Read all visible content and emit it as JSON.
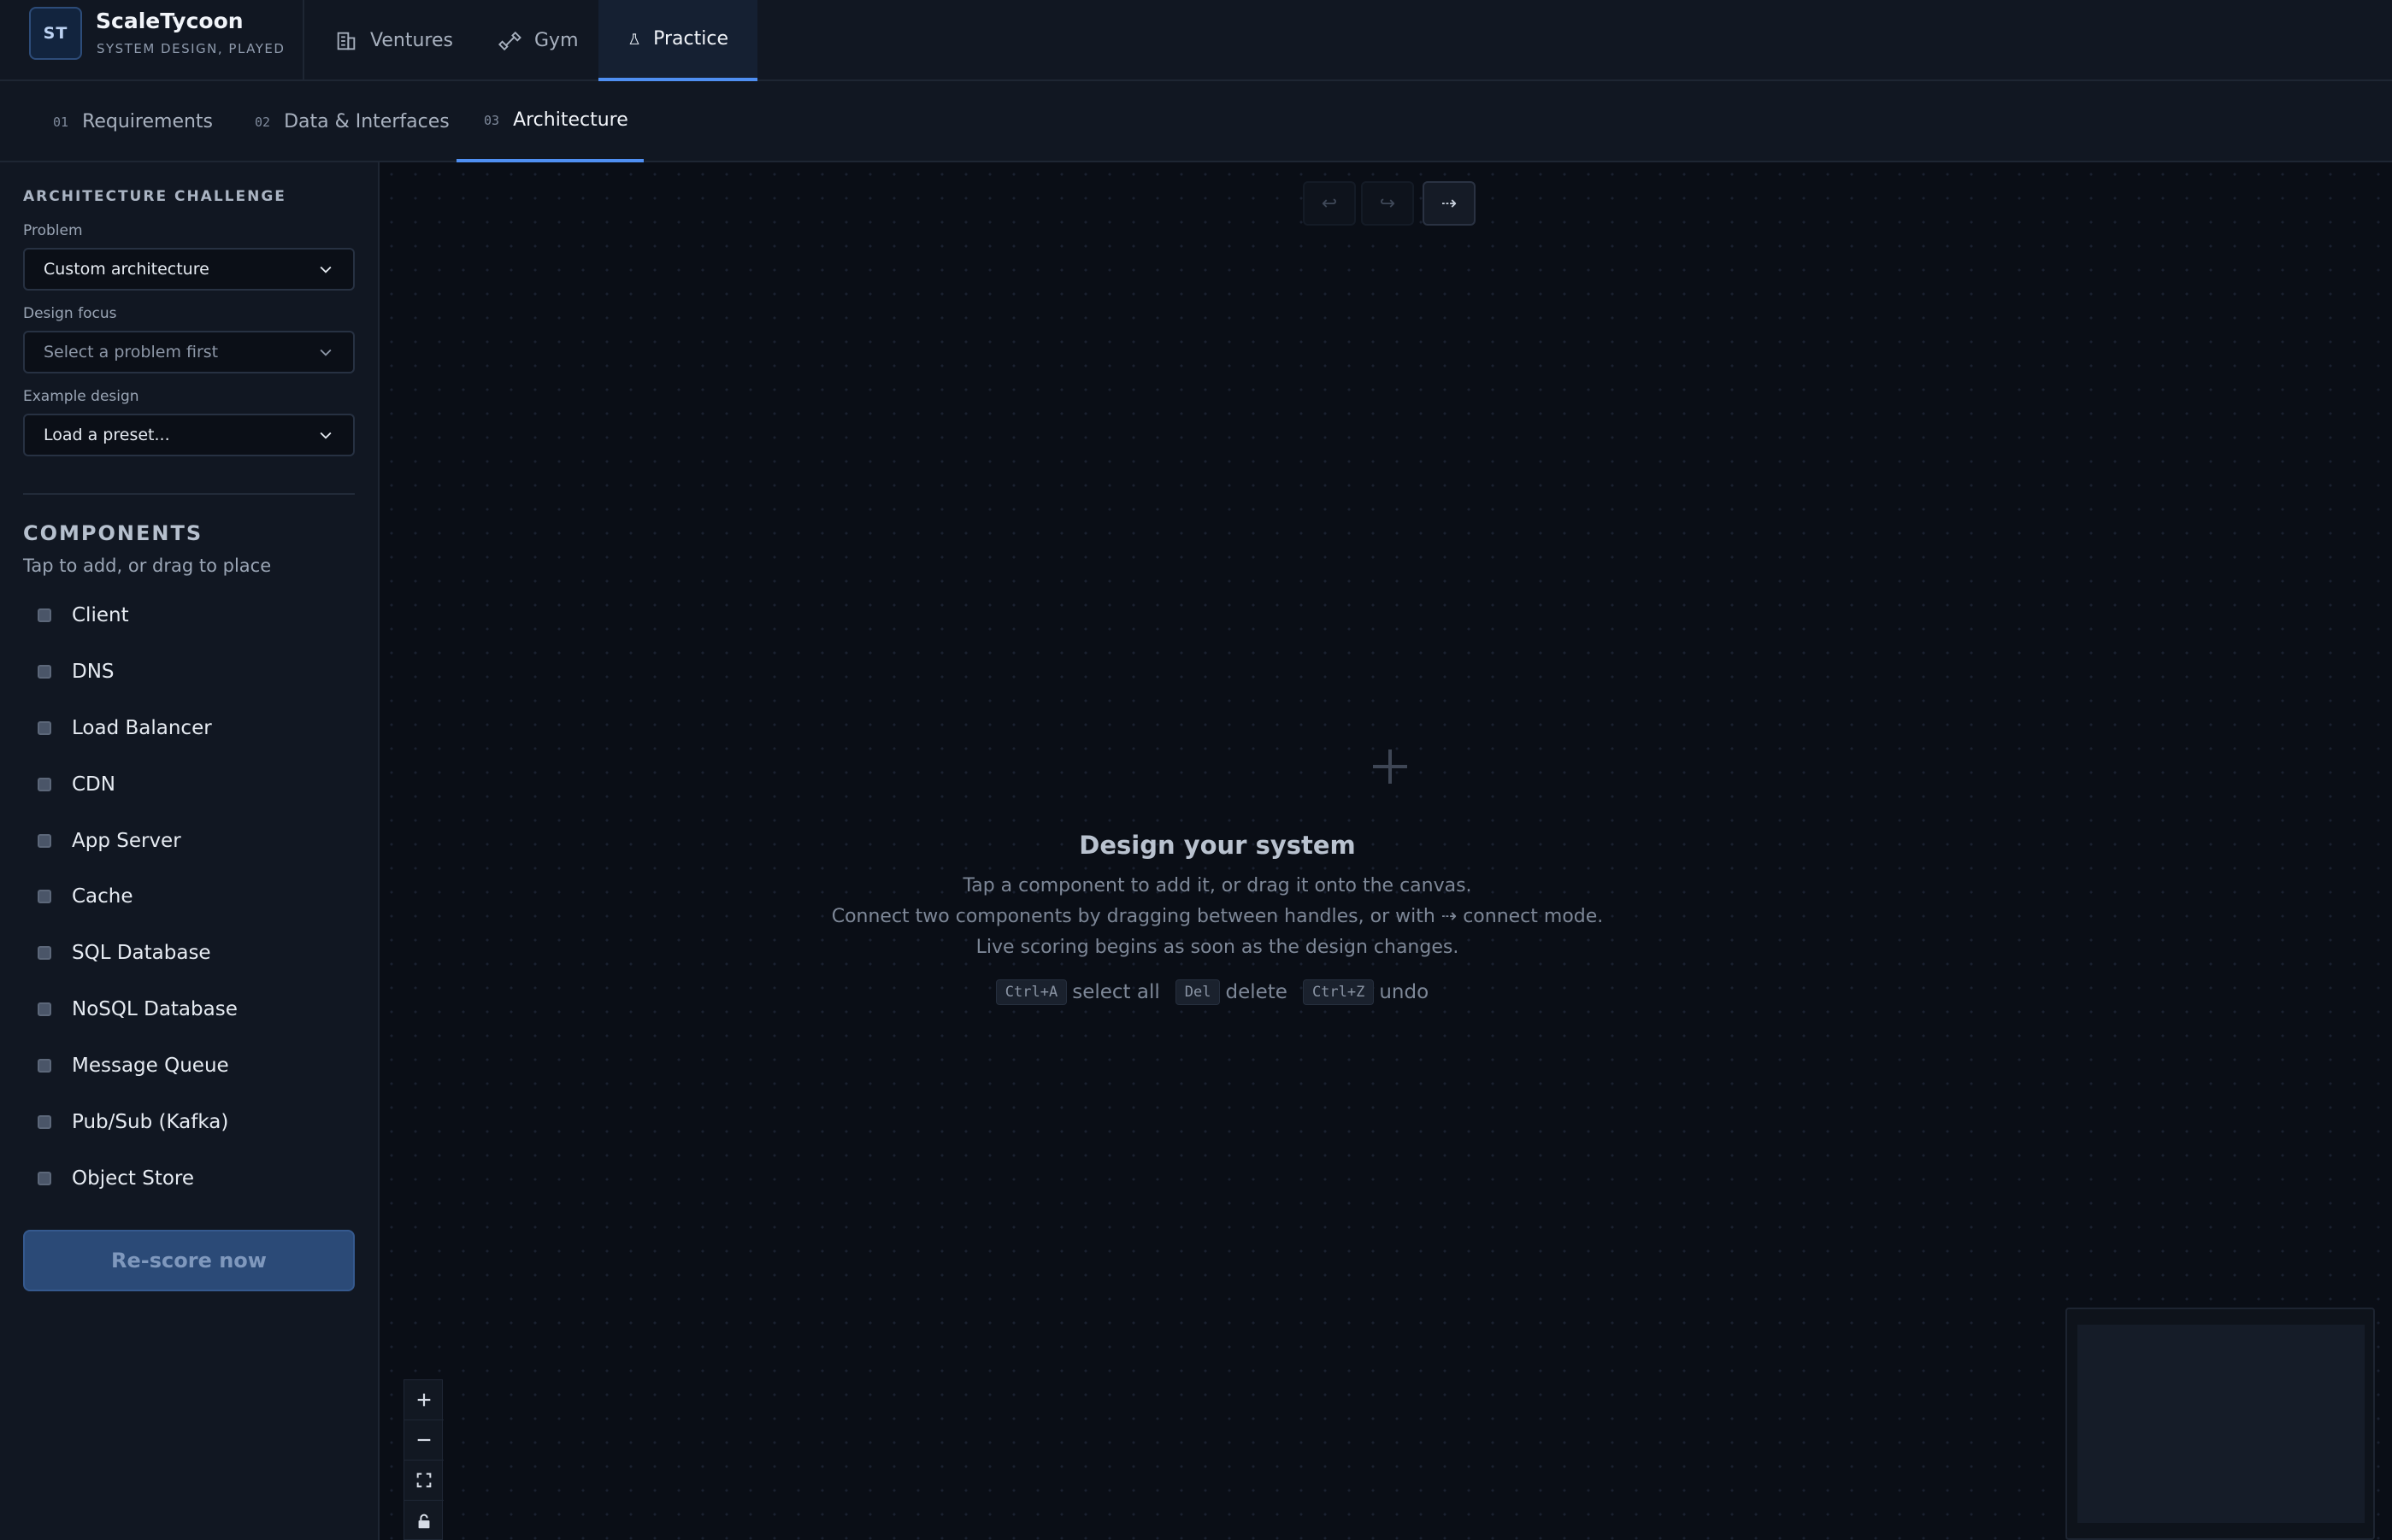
{
  "brand": {
    "logo": "ST",
    "name": "ScaleTycoon",
    "tagline": "SYSTEM DESIGN, PLAYED"
  },
  "nav": [
    {
      "label": "Ventures",
      "icon": "building-icon",
      "active": false
    },
    {
      "label": "Gym",
      "icon": "dumbbell-icon",
      "active": false
    },
    {
      "label": "Practice",
      "icon": "flask-icon",
      "active": true
    }
  ],
  "steps": [
    {
      "num": "01",
      "label": "Requirements",
      "active": false
    },
    {
      "num": "02",
      "label": "Data & Interfaces",
      "active": false
    },
    {
      "num": "03",
      "label": "Architecture",
      "active": true
    }
  ],
  "sidebar": {
    "title": "ARCHITECTURE CHALLENGE",
    "problem": {
      "label": "Problem",
      "value": "Custom architecture"
    },
    "focus": {
      "label": "Design focus",
      "value": "Select a problem first"
    },
    "example": {
      "label": "Example design",
      "value": "Load a preset..."
    },
    "components_title": "COMPONENTS",
    "components_sub": "Tap to add, or drag to place",
    "components": [
      "Client",
      "DNS",
      "Load Balancer",
      "CDN",
      "App Server",
      "Cache",
      "SQL Database",
      "NoSQL Database",
      "Message Queue",
      "Pub/Sub (Kafka)",
      "Object Store"
    ],
    "rescore_label": "Re-score now"
  },
  "canvas": {
    "toolbar": {
      "undo": "↩",
      "redo": "↪",
      "connect": "⇢"
    },
    "empty_title": "Design your system",
    "empty_lines": [
      "Tap a component to add it, or drag it onto the canvas.",
      "Connect two components by dragging between handles, or with ⇢ connect mode.",
      "Live scoring begins as soon as the design changes."
    ],
    "shortcuts": [
      {
        "key": "Ctrl+A",
        "text": "select all"
      },
      {
        "key": "Del",
        "text": "delete"
      },
      {
        "key": "Ctrl+Z",
        "text": "undo"
      }
    ]
  },
  "colors": {
    "accent": "#4f8ff2",
    "bg": "#0b0f17",
    "panel": "#111722",
    "button": "#2b4a77"
  }
}
